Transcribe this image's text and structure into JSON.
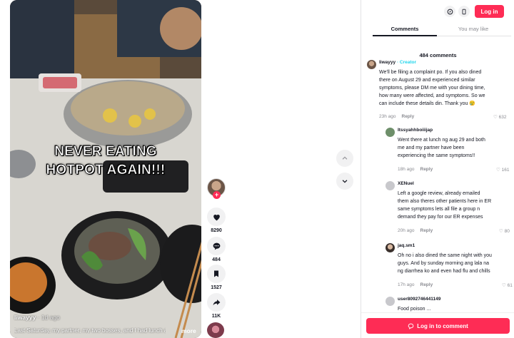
{
  "video": {
    "overlay_line1": "NEVER EATING",
    "overlay_line2": "HOTPOT AGAIN!!!",
    "author": "liwayyy",
    "time": "· 1d ago",
    "caption": "Last Saturday, my partner, my two bosses, and I had lunch at a",
    "more": "more"
  },
  "actions": {
    "likes": "8290",
    "comments": "484",
    "saves": "1527",
    "shares": "11K"
  },
  "header": {
    "login_label": "Log in"
  },
  "tabs": [
    {
      "label": "Comments",
      "active": true
    },
    {
      "label": "You may like",
      "active": false
    }
  ],
  "comment_count": "484 comments",
  "comments": [
    {
      "author": "liwayyy",
      "badge": "· Creator",
      "lines": [
        "We'll be filing a complaint po. If you also dined",
        "there on August 29 and experienced similar",
        "symptoms, please DM me with your dining time,",
        "how many were affected, and symptoms. So we",
        "can include these details din. Thank you 😢"
      ],
      "time": "23h ago",
      "reply": "Reply",
      "likes": "632"
    },
    {
      "author": "Itssyahhboiiijap",
      "lines": [
        "Went there at lunch ng aug 29 and both",
        "me and my partner have been",
        "experiencing the same symptoms!!"
      ],
      "time": "18h ago",
      "reply": "Reply",
      "likes": "161"
    },
    {
      "author": "XENuel",
      "lines": [
        "Left a google review, already emailed",
        "them also theres other patients here in ER",
        "same symptoms lets all file a group n",
        "demand they pay for our ER expenses"
      ],
      "time": "20h ago",
      "reply": "Reply",
      "likes": "80"
    },
    {
      "author": "jaq.sm1",
      "lines": [
        "Oh no i also dined the same night with you",
        "guys. And by sunday morning ang lala na",
        "ng diarrhea ko and even had flu and chills"
      ],
      "time": "17h ago",
      "reply": "Reply",
      "likes": "61"
    },
    {
      "author": "user8092746441149",
      "lines": [
        "Food poison ..."
      ],
      "time": "",
      "reply": "",
      "likes": ""
    }
  ],
  "bottom": {
    "login_to_comment": "Log in to comment"
  },
  "colors": {
    "accent": "#fe2c55",
    "creator": "#20d5ec"
  }
}
